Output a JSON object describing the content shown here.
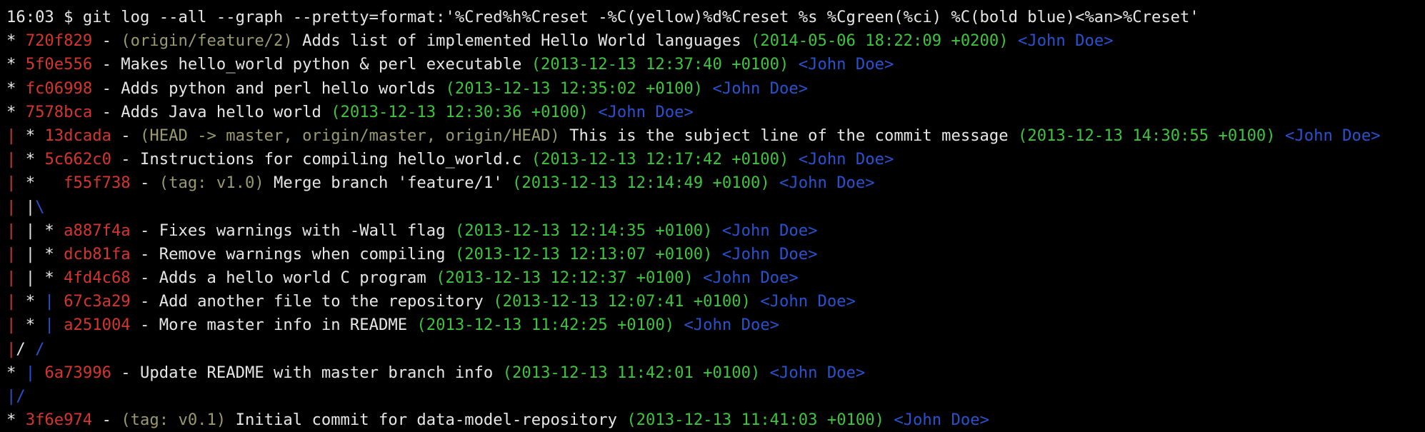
{
  "palette": {
    "white": "#e6e6e6",
    "red": "#d2362f",
    "yellow": "#9a9a6c",
    "green": "#3ec43e",
    "blue": "#2a52cf",
    "background": "#000000"
  },
  "terminal": {
    "lines": [
      [
        {
          "t": "16:03 $ git log --all --graph --pretty=format:'%Cred%h%Creset -%C(yellow)%d%Creset %s %Cgreen(%ci) %C(bold blue)<%an>%Creset'",
          "c": "white"
        }
      ],
      [
        {
          "t": "* ",
          "c": "white"
        },
        {
          "t": "720f829",
          "c": "red"
        },
        {
          "t": " - ",
          "c": "white"
        },
        {
          "t": "(origin/feature/2)",
          "c": "yellow"
        },
        {
          "t": " Adds list of implemented Hello World languages ",
          "c": "white"
        },
        {
          "t": "(2014-05-06 18:22:09 +0200)",
          "c": "green"
        },
        {
          "t": " ",
          "c": "white"
        },
        {
          "t": "<John Doe>",
          "c": "blue"
        }
      ],
      [
        {
          "t": "* ",
          "c": "white"
        },
        {
          "t": "5f0e556",
          "c": "red"
        },
        {
          "t": " - Makes hello_world python & perl executable ",
          "c": "white"
        },
        {
          "t": "(2013-12-13 12:37:40 +0100)",
          "c": "green"
        },
        {
          "t": " ",
          "c": "white"
        },
        {
          "t": "<John Doe>",
          "c": "blue"
        }
      ],
      [
        {
          "t": "* ",
          "c": "white"
        },
        {
          "t": "fc06998",
          "c": "red"
        },
        {
          "t": " - Adds python and perl hello worlds ",
          "c": "white"
        },
        {
          "t": "(2013-12-13 12:35:02 +0100)",
          "c": "green"
        },
        {
          "t": " ",
          "c": "white"
        },
        {
          "t": "<John Doe>",
          "c": "blue"
        }
      ],
      [
        {
          "t": "* ",
          "c": "white"
        },
        {
          "t": "7578bca",
          "c": "red"
        },
        {
          "t": " - Adds Java hello world ",
          "c": "white"
        },
        {
          "t": "(2013-12-13 12:30:36 +0100)",
          "c": "green"
        },
        {
          "t": " ",
          "c": "white"
        },
        {
          "t": "<John Doe>",
          "c": "blue"
        }
      ],
      [
        {
          "t": "|",
          "c": "red"
        },
        {
          "t": " * ",
          "c": "white"
        },
        {
          "t": "13dcada",
          "c": "red"
        },
        {
          "t": " - ",
          "c": "white"
        },
        {
          "t": "(HEAD -> master, origin/master, origin/HEAD)",
          "c": "yellow"
        },
        {
          "t": " This is the subject line of the commit message ",
          "c": "white"
        },
        {
          "t": "(2013-12-13 14:30:55 +0100)",
          "c": "green"
        },
        {
          "t": " ",
          "c": "white"
        },
        {
          "t": "<John Doe>",
          "c": "blue"
        }
      ],
      [
        {
          "t": "|",
          "c": "red"
        },
        {
          "t": " * ",
          "c": "white"
        },
        {
          "t": "5c662c0",
          "c": "red"
        },
        {
          "t": " - Instructions for compiling hello_world.c ",
          "c": "white"
        },
        {
          "t": "(2013-12-13 12:17:42 +0100)",
          "c": "green"
        },
        {
          "t": " ",
          "c": "white"
        },
        {
          "t": "<John Doe>",
          "c": "blue"
        }
      ],
      [
        {
          "t": "|",
          "c": "red"
        },
        {
          "t": " *   ",
          "c": "white"
        },
        {
          "t": "f55f738",
          "c": "red"
        },
        {
          "t": " - ",
          "c": "white"
        },
        {
          "t": "(tag: v1.0)",
          "c": "yellow"
        },
        {
          "t": " Merge branch 'feature/1' ",
          "c": "white"
        },
        {
          "t": "(2013-12-13 12:14:49 +0100)",
          "c": "green"
        },
        {
          "t": " ",
          "c": "white"
        },
        {
          "t": "<John Doe>",
          "c": "blue"
        }
      ],
      [
        {
          "t": "|",
          "c": "red"
        },
        {
          "t": " ",
          "c": "white"
        },
        {
          "t": "|",
          "c": "white"
        },
        {
          "t": "\\",
          "c": "blue"
        }
      ],
      [
        {
          "t": "|",
          "c": "red"
        },
        {
          "t": " | * ",
          "c": "white"
        },
        {
          "t": "a887f4a",
          "c": "red"
        },
        {
          "t": " - Fixes warnings with -Wall flag ",
          "c": "white"
        },
        {
          "t": "(2013-12-13 12:14:35 +0100)",
          "c": "green"
        },
        {
          "t": " ",
          "c": "white"
        },
        {
          "t": "<John Doe>",
          "c": "blue"
        }
      ],
      [
        {
          "t": "|",
          "c": "red"
        },
        {
          "t": " | * ",
          "c": "white"
        },
        {
          "t": "dcb81fa",
          "c": "red"
        },
        {
          "t": " - Remove warnings when compiling ",
          "c": "white"
        },
        {
          "t": "(2013-12-13 12:13:07 +0100)",
          "c": "green"
        },
        {
          "t": " ",
          "c": "white"
        },
        {
          "t": "<John Doe>",
          "c": "blue"
        }
      ],
      [
        {
          "t": "|",
          "c": "red"
        },
        {
          "t": " | * ",
          "c": "white"
        },
        {
          "t": "4fd4c68",
          "c": "red"
        },
        {
          "t": " - Adds a hello world C program ",
          "c": "white"
        },
        {
          "t": "(2013-12-13 12:12:37 +0100)",
          "c": "green"
        },
        {
          "t": " ",
          "c": "white"
        },
        {
          "t": "<John Doe>",
          "c": "blue"
        }
      ],
      [
        {
          "t": "|",
          "c": "red"
        },
        {
          "t": " * ",
          "c": "white"
        },
        {
          "t": "|",
          "c": "blue"
        },
        {
          "t": " ",
          "c": "white"
        },
        {
          "t": "67c3a29",
          "c": "red"
        },
        {
          "t": " - Add another file to the repository ",
          "c": "white"
        },
        {
          "t": "(2013-12-13 12:07:41 +0100)",
          "c": "green"
        },
        {
          "t": " ",
          "c": "white"
        },
        {
          "t": "<John Doe>",
          "c": "blue"
        }
      ],
      [
        {
          "t": "|",
          "c": "red"
        },
        {
          "t": " * ",
          "c": "white"
        },
        {
          "t": "|",
          "c": "blue"
        },
        {
          "t": " ",
          "c": "white"
        },
        {
          "t": "a251004",
          "c": "red"
        },
        {
          "t": " - More master info in README ",
          "c": "white"
        },
        {
          "t": "(2013-12-13 11:42:25 +0100)",
          "c": "green"
        },
        {
          "t": " ",
          "c": "white"
        },
        {
          "t": "<John Doe>",
          "c": "blue"
        }
      ],
      [
        {
          "t": "|",
          "c": "red"
        },
        {
          "t": "/",
          "c": "white"
        },
        {
          "t": " ",
          "c": "white"
        },
        {
          "t": "/",
          "c": "blue"
        }
      ],
      [
        {
          "t": "* ",
          "c": "white"
        },
        {
          "t": "|",
          "c": "blue"
        },
        {
          "t": " ",
          "c": "white"
        },
        {
          "t": "6a73996",
          "c": "red"
        },
        {
          "t": " - Update README with master branch info ",
          "c": "white"
        },
        {
          "t": "(2013-12-13 11:42:01 +0100)",
          "c": "green"
        },
        {
          "t": " ",
          "c": "white"
        },
        {
          "t": "<John Doe>",
          "c": "blue"
        }
      ],
      [
        {
          "t": "|/",
          "c": "blue"
        }
      ],
      [
        {
          "t": "* ",
          "c": "white"
        },
        {
          "t": "3f6e974",
          "c": "red"
        },
        {
          "t": " - ",
          "c": "white"
        },
        {
          "t": "(tag: v0.1)",
          "c": "yellow"
        },
        {
          "t": " Initial commit for data-model-repository ",
          "c": "white"
        },
        {
          "t": "(2013-12-13 11:41:03 +0100)",
          "c": "green"
        },
        {
          "t": " ",
          "c": "white"
        },
        {
          "t": "<John Doe>",
          "c": "blue"
        }
      ]
    ]
  }
}
